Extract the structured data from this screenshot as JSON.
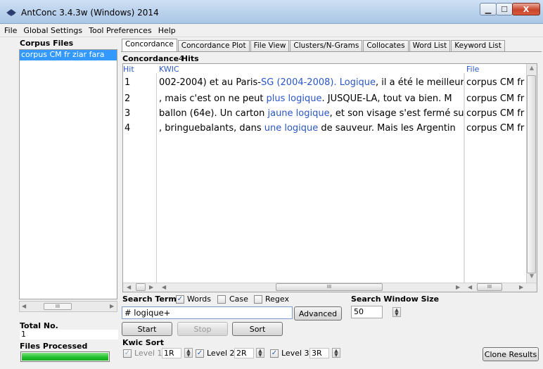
{
  "window": {
    "title": "AntConc 3.4.3w (Windows) 2014",
    "min_icon": "minimize-icon",
    "max_icon": "maximize-icon",
    "close_icon": "close-icon",
    "close_glyph": "X"
  },
  "menu": [
    "File",
    "Global Settings",
    "Tool Preferences",
    "Help"
  ],
  "left": {
    "corpus_files_label": "Corpus Files",
    "corpus_files": [
      "corpus CM fr ziar fara"
    ],
    "total_no_label": "Total No.",
    "total_no_value": "1",
    "files_processed_label": "Files Processed",
    "progress": 1.0
  },
  "tabs": [
    {
      "label": "Concordance",
      "active": true
    },
    {
      "label": "Concordance Plot",
      "active": false
    },
    {
      "label": "File View",
      "active": false
    },
    {
      "label": "Clusters/N-Grams",
      "active": false
    },
    {
      "label": "Collocates",
      "active": false
    },
    {
      "label": "Word List",
      "active": false
    },
    {
      "label": "Keyword List",
      "active": false
    }
  ],
  "concordance": {
    "hits_label": "Concordance Hits",
    "hits_count": "4",
    "columns": {
      "hit": "Hit",
      "kwic": "KWIC",
      "file": "File"
    },
    "rows": [
      {
        "hit": "1",
        "left": "002-2004) et au Paris-",
        "match": "SG (2004-2008). Logique",
        "right": ", il a été le meilleur",
        "file": "corpus CM fr"
      },
      {
        "hit": "2",
        "left": ", mais c'est on ne peut ",
        "match": "plus logique",
        "right": ".  JUSQUE-LÀ, tout va bien. M",
        "file": "corpus CM fr"
      },
      {
        "hit": "3",
        "left": "ballon (64e). Un carton ",
        "match": "jaune logique",
        "right": ", et son visage s'est fermé su",
        "file": "corpus CM fr"
      },
      {
        "hit": "4",
        "left": ", bringuebalants, dans ",
        "match": "une logique",
        "right": " de sauveur. Mais les Argentin",
        "file": "corpus CM fr"
      }
    ]
  },
  "search": {
    "term_label": "Search Term",
    "words_label": "Words",
    "words_checked": true,
    "case_label": "Case",
    "case_checked": false,
    "regex_label": "Regex",
    "regex_checked": false,
    "term_value": "# logique+",
    "advanced_label": "Advanced",
    "window_size_label": "Search Window Size",
    "window_size_value": "50",
    "start_label": "Start",
    "stop_label": "Stop",
    "sort_label": "Sort"
  },
  "kwic_sort": {
    "label": "Kwic Sort",
    "level1_label": "Level 1",
    "level1_value": "1R",
    "level1_checked": true,
    "level2_label": "Level 2",
    "level2_value": "2R",
    "level2_checked": true,
    "level3_label": "Level 3",
    "level3_value": "3R",
    "level3_checked": true,
    "clone_label": "Clone Results"
  },
  "scroll": {
    "thumb_glyph": "III"
  }
}
